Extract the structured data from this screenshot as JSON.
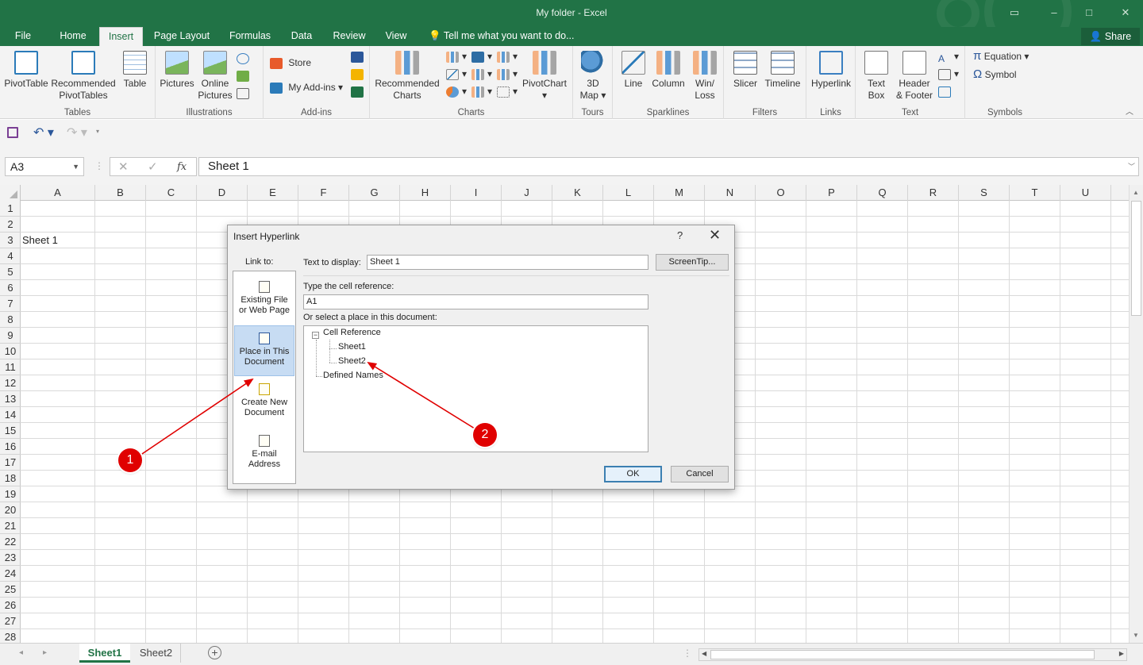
{
  "window": {
    "title": "My folder - Excel",
    "controls": [
      "▭",
      "–",
      "□",
      "✕"
    ]
  },
  "tabs": [
    {
      "label": "File"
    },
    {
      "label": "Home"
    },
    {
      "label": "Insert"
    },
    {
      "label": "Page Layout"
    },
    {
      "label": "Formulas"
    },
    {
      "label": "Data"
    },
    {
      "label": "Review"
    },
    {
      "label": "View"
    }
  ],
  "active_tab": "Insert",
  "tell_me": "Tell me what you want to do...",
  "share_label": "Share",
  "ribbon": {
    "groups": {
      "tables": "Tables",
      "illustrations": "Illustrations",
      "addins": "Add-ins",
      "charts": "Charts",
      "tours": "Tours",
      "sparklines": "Sparklines",
      "filters": "Filters",
      "links": "Links",
      "text": "Text",
      "symbols": "Symbols"
    },
    "buttons": {
      "pivottable": "PivotTable",
      "rec_pivot_1": "Recommended",
      "rec_pivot_2": "PivotTables",
      "table": "Table",
      "pictures": "Pictures",
      "online_1": "Online",
      "online_2": "Pictures",
      "store": "Store",
      "myaddins": "My Add-ins",
      "rec_charts_1": "Recommended",
      "rec_charts_2": "Charts",
      "pivotchart": "PivotChart",
      "map_1": "3D",
      "map_2": "Map",
      "line": "Line",
      "column": "Column",
      "winloss_1": "Win/",
      "winloss_2": "Loss",
      "slicer": "Slicer",
      "timeline": "Timeline",
      "hyperlink": "Hyperlink",
      "textbox_1": "Text",
      "textbox_2": "Box",
      "header_1": "Header",
      "header_2": "& Footer",
      "equation": "Equation",
      "symbol": "Symbol"
    }
  },
  "namebox": "A3",
  "formula": "Sheet 1",
  "columns": [
    "A",
    "B",
    "C",
    "D",
    "E",
    "F",
    "G",
    "H",
    "I",
    "J",
    "K",
    "L",
    "M",
    "N",
    "O",
    "P",
    "Q",
    "R",
    "S",
    "T",
    "U"
  ],
  "rows": [
    "1",
    "2",
    "3",
    "4",
    "5",
    "6",
    "7",
    "8",
    "9",
    "10",
    "11",
    "12",
    "13",
    "14",
    "15",
    "16",
    "17",
    "18",
    "19",
    "20",
    "21",
    "22",
    "23",
    "24",
    "25",
    "26",
    "27",
    "28"
  ],
  "cell_a3": "Sheet 1",
  "sheets": [
    "Sheet1",
    "Sheet2"
  ],
  "active_sheet": "Sheet1",
  "dialog": {
    "title": "Insert Hyperlink",
    "help": "?",
    "close": "✕",
    "link_to": "Link to:",
    "link_items": [
      {
        "l1": "Existing File",
        "l2": "or Web Page"
      },
      {
        "l1": "Place in This",
        "l2": "Document"
      },
      {
        "l1": "Create New",
        "l2": "Document"
      },
      {
        "l1": "E-mail",
        "l2": "Address"
      }
    ],
    "text_to_display_label": "Text to display:",
    "text_to_display_value": "Sheet 1",
    "screentip": "ScreenTip...",
    "cell_ref_label": "Type the cell reference:",
    "cell_ref_value": "A1",
    "place_label": "Or select a place in this document:",
    "tree": {
      "root": "Cell Reference",
      "children": [
        "Sheet1",
        "Sheet2"
      ],
      "defined": "Defined Names"
    },
    "ok": "OK",
    "cancel": "Cancel"
  },
  "annotations": [
    "1",
    "2"
  ],
  "colors": {
    "accent": "#217346",
    "annotation": "#e00000"
  }
}
